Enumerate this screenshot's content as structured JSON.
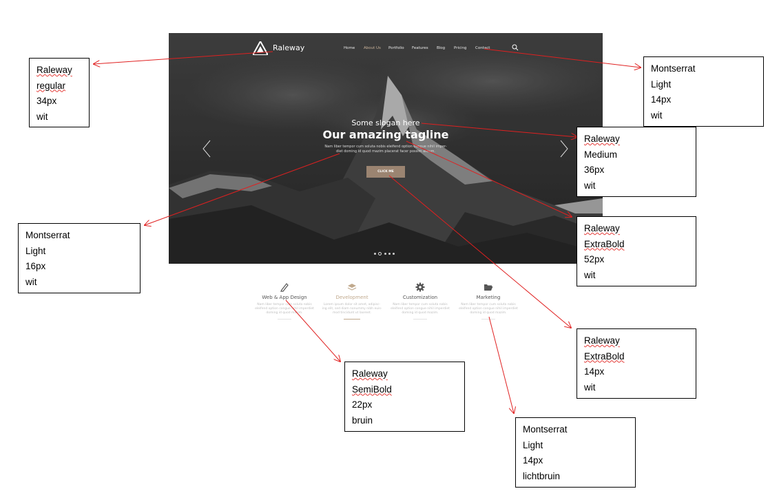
{
  "site": {
    "logo_text": "Raleway",
    "nav": [
      "Home",
      "About Us",
      "Portfolio",
      "Features",
      "Blog",
      "Pricing",
      "Contact"
    ],
    "active_nav": "About Us",
    "hero": {
      "slogan": "Some slogan here",
      "tagline": "Our amazing tagline",
      "lead_line1": "Nam liber tempor cum soluta nobis eleifend option congue nihil imper-",
      "lead_line2": "diet doming id quod mazim placerat facer possim assum.",
      "button": "CLICK ME"
    },
    "features": [
      {
        "icon": "pen-icon",
        "title": "Web & App Design",
        "desc1": "Nam liber tempor cum soluta nobis",
        "desc2": "eleifend option congue nihil imperdiet",
        "desc3": "doming id quod mazim."
      },
      {
        "icon": "layers-icon",
        "title": "Development",
        "desc1": "Lorem ipsum dolor sit amet, adipisc-",
        "desc2": "ing elit, sed diam nonummy nibh euis-",
        "desc3": "mod tincidunt ut laoreet."
      },
      {
        "icon": "gear-icon",
        "title": "Customization",
        "desc1": "Nam liber tempor cum soluta nobis",
        "desc2": "eleifend option congue nihil imperdiet",
        "desc3": "doming id quod mazim."
      },
      {
        "icon": "folder-open-icon",
        "title": "Marketing",
        "desc1": "Nam liber tempor cum soluta nobis",
        "desc2": "eleifend option congue nihil imperdiet",
        "desc3": "doming id quod mazim."
      }
    ]
  },
  "annotations": {
    "logo": [
      "Raleway",
      "regular",
      "34px",
      "wit"
    ],
    "nav": [
      "Montserrat",
      "Light",
      "14px",
      "wit"
    ],
    "slogan": [
      "Raleway",
      "Medium",
      "36px",
      "wit"
    ],
    "tagline": [
      "Raleway",
      "ExtraBold",
      "52px",
      "wit"
    ],
    "button": [
      "Raleway",
      "ExtraBold",
      "14px",
      "wit"
    ],
    "lead": [
      "Montserrat",
      "Light",
      "16px",
      "wit"
    ],
    "feature_title": [
      "Raleway",
      "SemiBold",
      "22px",
      "bruin"
    ],
    "feature_desc": [
      "Montserrat",
      "Light",
      "14px",
      "lichtbruin"
    ]
  },
  "colors": {
    "accent_brown": "#9b8471",
    "feature_brown": "#c0a98d",
    "arrow_red": "#e02020"
  }
}
